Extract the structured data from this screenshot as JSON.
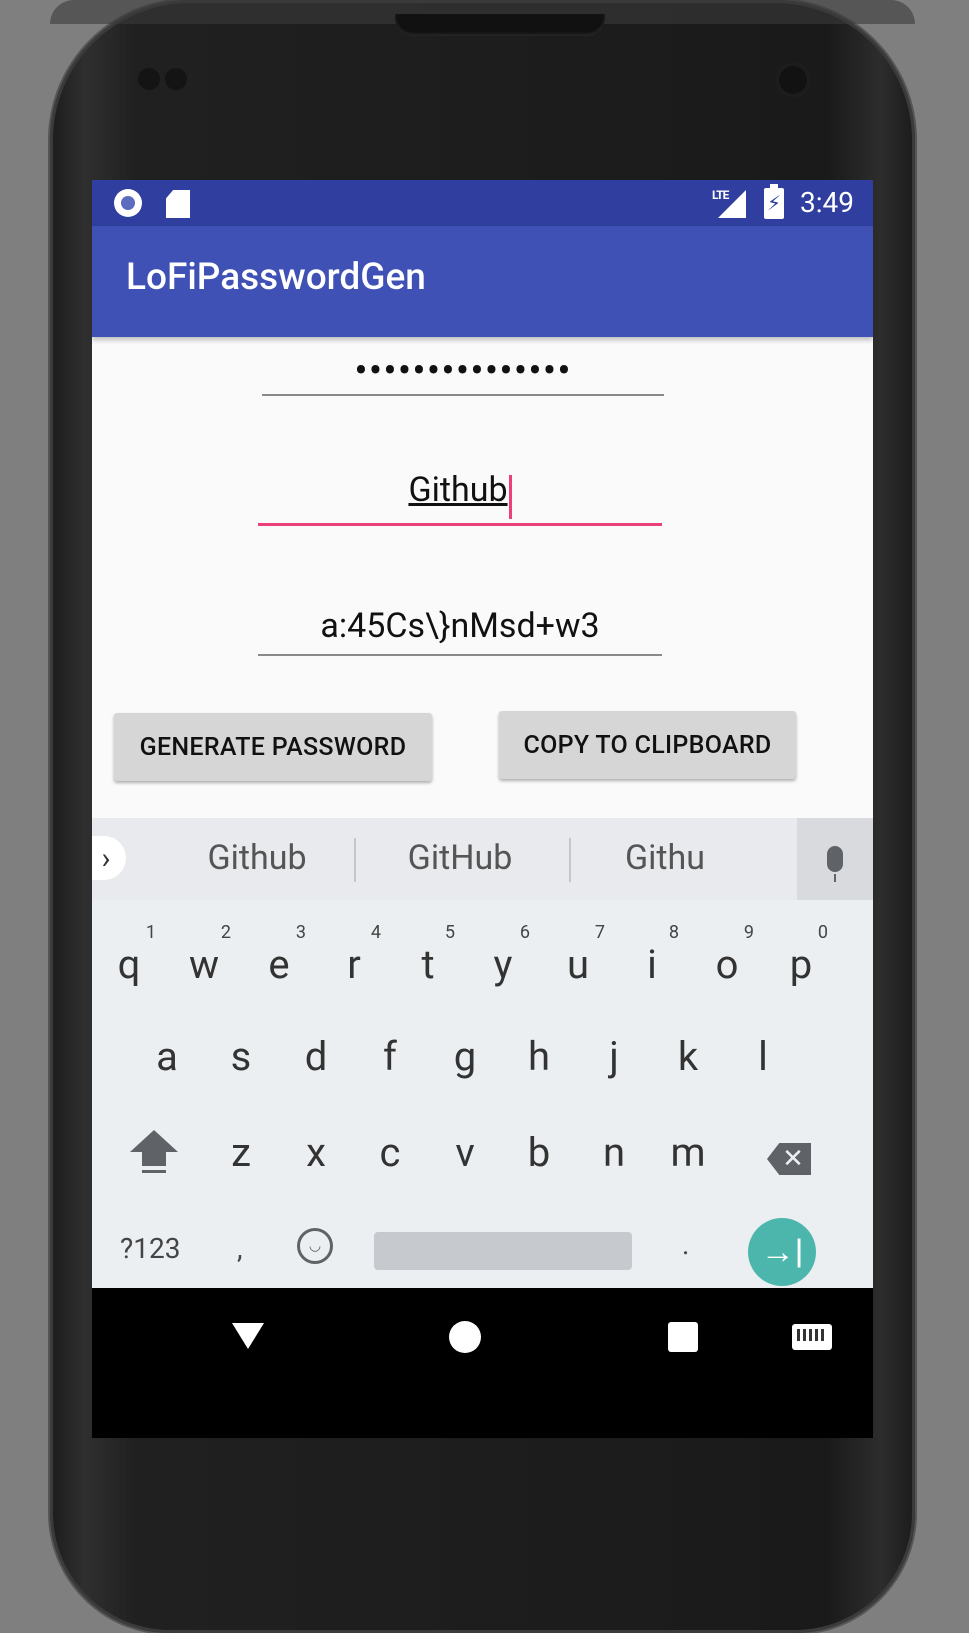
{
  "status_bar": {
    "network": "LTE",
    "battery_symbol": "⚡",
    "time": "3:49"
  },
  "app": {
    "title": "LoFiPasswordGen"
  },
  "form": {
    "master_password_masked": "•••••••••••••••",
    "site_value": "Github",
    "generated_password": "a:45Cs\\}nMsd+w3"
  },
  "buttons": {
    "generate": "GENERATE PASSWORD",
    "copy": "COPY TO CLIPBOARD"
  },
  "keyboard": {
    "suggestions": [
      "Github",
      "GitHub",
      "Githu"
    ],
    "row1": [
      {
        "k": "q",
        "n": "1"
      },
      {
        "k": "w",
        "n": "2"
      },
      {
        "k": "e",
        "n": "3"
      },
      {
        "k": "r",
        "n": "4"
      },
      {
        "k": "t",
        "n": "5"
      },
      {
        "k": "y",
        "n": "6"
      },
      {
        "k": "u",
        "n": "7"
      },
      {
        "k": "i",
        "n": "8"
      },
      {
        "k": "o",
        "n": "9"
      },
      {
        "k": "p",
        "n": "0"
      }
    ],
    "row2": [
      "a",
      "s",
      "d",
      "f",
      "g",
      "h",
      "j",
      "k",
      "l"
    ],
    "row3": [
      "z",
      "x",
      "c",
      "v",
      "b",
      "n",
      "m"
    ],
    "symbols_label": "?123",
    "comma": ",",
    "period": ".",
    "enter_symbol": "→|",
    "backspace_symbol": "✕",
    "expand_symbol": "›"
  }
}
